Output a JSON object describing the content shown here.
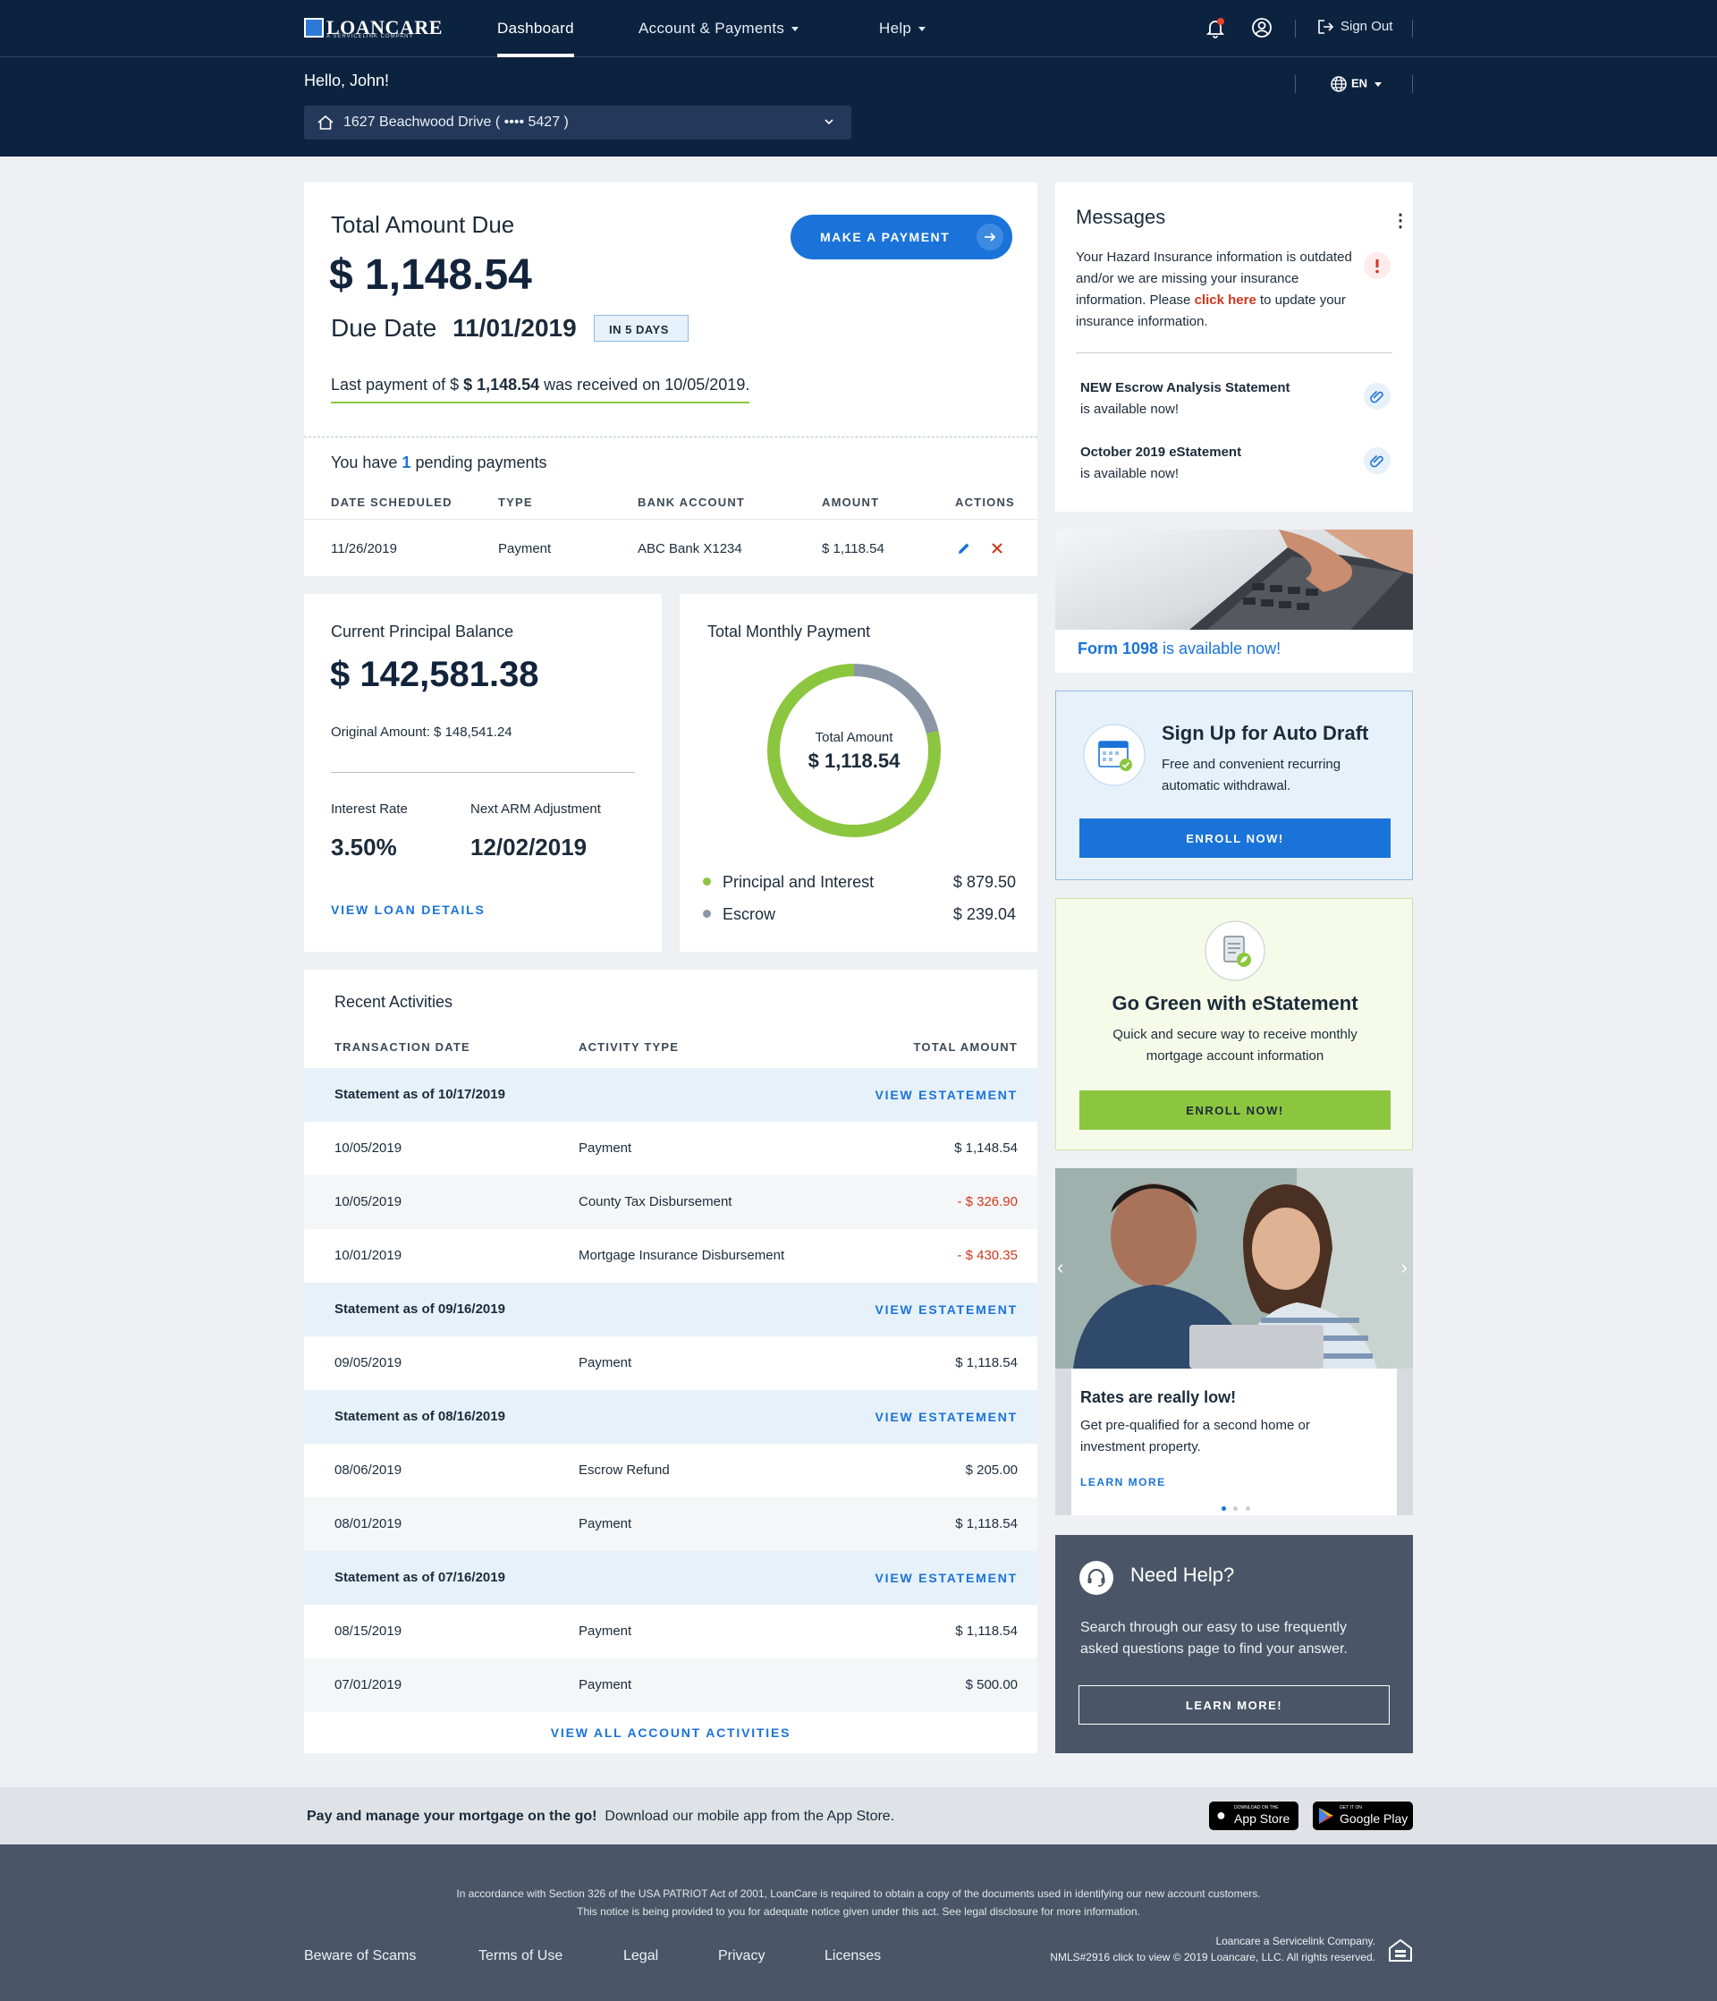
{
  "nav": {
    "brand": "LOANCARE",
    "brand_sub": "A SERVICELINK COMPANY",
    "dashboard": "Dashboard",
    "account_payments": "Account & Payments",
    "help": "Help",
    "sign_out": "Sign Out",
    "lang": "EN"
  },
  "greeting": "Hello, John!",
  "property": "1627 Beachwood Drive ( •••• 5427 )",
  "due": {
    "title": "Total Amount Due",
    "amount": "$ 1,148.54",
    "due_label": "Due Date",
    "due_date": "11/01/2019",
    "badge": "IN 5 DAYS",
    "make_payment": "MAKE A PAYMENT",
    "last_payment_pre": "Last payment of $ ",
    "last_payment_amount": "$ 1,148.54",
    "last_payment_post": " was received on 10/05/2019."
  },
  "pending": {
    "pre": "You have ",
    "count": "1",
    "post": " pending payments",
    "headers": [
      "DATE SCHEDULED",
      "TYPE",
      "BANK ACCOUNT",
      "AMOUNT",
      "ACTIONS"
    ],
    "rows": [
      {
        "date": "11/26/2019",
        "type": "Payment",
        "bank": "ABC Bank X1234",
        "amount": "$ 1,118.54"
      }
    ]
  },
  "principal": {
    "title": "Current Principal Balance",
    "amount": "$ 142,581.38",
    "original": "Original Amount: $ 148,541.24",
    "rate_label": "Interest Rate",
    "rate": "3.50%",
    "arm_label": "Next ARM Adjustment",
    "arm": "12/02/2019",
    "link": "VIEW LOAN DETAILS"
  },
  "monthly": {
    "title": "Total Monthly Payment",
    "center_label": "Total Amount",
    "center_value": "$ 1,118.54",
    "items": [
      {
        "label": "Principal and Interest",
        "value": "$ 879.50",
        "color": "#8cc63f",
        "amount": 879.5
      },
      {
        "label": "Escrow",
        "value": "$ 239.04",
        "color": "#8a96a5",
        "amount": 239.04
      }
    ]
  },
  "activities": {
    "title": "Recent Activities",
    "headers": [
      "TRANSACTION DATE",
      "ACTIVITY TYPE",
      "TOTAL AMOUNT"
    ],
    "view_statement": "VIEW ESTATEMENT",
    "rows": [
      {
        "kind": "stmt",
        "label": "Statement as of 10/17/2019"
      },
      {
        "kind": "tx",
        "date": "10/05/2019",
        "type": "Payment",
        "amount": "$ 1,148.54",
        "neg": false
      },
      {
        "kind": "tx",
        "date": "10/05/2019",
        "type": "County Tax Disbursement",
        "amount": "- $ 326.90",
        "neg": true
      },
      {
        "kind": "tx",
        "date": "10/01/2019",
        "type": "Mortgage Insurance Disbursement",
        "amount": "- $ 430.35",
        "neg": true
      },
      {
        "kind": "stmt",
        "label": "Statement as of 09/16/2019"
      },
      {
        "kind": "tx",
        "date": "09/05/2019",
        "type": "Payment",
        "amount": "$ 1,118.54",
        "neg": false
      },
      {
        "kind": "stmt",
        "label": "Statement as of 08/16/2019"
      },
      {
        "kind": "tx",
        "date": "08/06/2019",
        "type": "Escrow Refund",
        "amount": "$ 205.00",
        "neg": false
      },
      {
        "kind": "tx",
        "date": "08/01/2019",
        "type": "Payment",
        "amount": "$ 1,118.54",
        "neg": false
      },
      {
        "kind": "stmt",
        "label": "Statement as of 07/16/2019"
      },
      {
        "kind": "tx",
        "date": "08/15/2019",
        "type": "Payment",
        "amount": "$ 1,118.54",
        "neg": false
      },
      {
        "kind": "tx",
        "date": "07/01/2019",
        "type": "Payment",
        "amount": "$ 500.00",
        "neg": false
      }
    ],
    "view_all": "VIEW ALL ACCOUNT ACTIVITIES"
  },
  "messages": {
    "title": "Messages",
    "alert_text": "Your Hazard Insurance information is outdated and/or we are missing your insurance information. Please ",
    "alert_link": "click here",
    "alert_post": " to update your insurance information.",
    "items": [
      {
        "bold": "NEW Escrow Analysis Statement",
        "sub": "is available now!"
      },
      {
        "bold": "October 2019 eStatement",
        "sub": "is available now!"
      }
    ]
  },
  "form1098": {
    "bold": "Form 1098",
    "rest": " is available now!"
  },
  "autodraft": {
    "title": "Sign Up for Auto Draft",
    "body": "Free and convenient recurring automatic withdrawal.",
    "button": "ENROLL NOW!"
  },
  "gogreen": {
    "title": "Go Green with eStatement",
    "body": "Quick and secure way to receive monthly mortgage account information",
    "button": "ENROLL NOW!"
  },
  "promo": {
    "title": "Rates are really low!",
    "body": "Get pre-qualified for a second home or investment property.",
    "link": "LEARN MORE"
  },
  "help": {
    "title": "Need Help?",
    "body": "Search through our easy to use frequently asked questions page to find your answer.",
    "button": "LEARN MORE!"
  },
  "app_band": {
    "bold": "Pay and manage your mortgage on the go!",
    "rest": "Download our mobile app from the App Store.",
    "appstore_small": "DOWNLOAD ON THE",
    "appstore": "App Store",
    "gplay_small": "GET IT ON",
    "gplay": "Google Play"
  },
  "footer": {
    "notice": "In accordance with Section 326 of the USA PATRIOT Act of 2001, LoanCare is required to obtain a copy of the documents used in identifying our new account customers. This notice is being provided to you for adequate notice given under this act. See legal disclosure for more information.",
    "links": [
      "Beware of Scams",
      "Terms of Use",
      "Legal",
      "Privacy",
      "Licenses"
    ],
    "company": "Loancare a Servicelink Company.",
    "nmls": "NMLS#2916 click to view © 2019 Loancare, LLC. All rights reserved."
  }
}
